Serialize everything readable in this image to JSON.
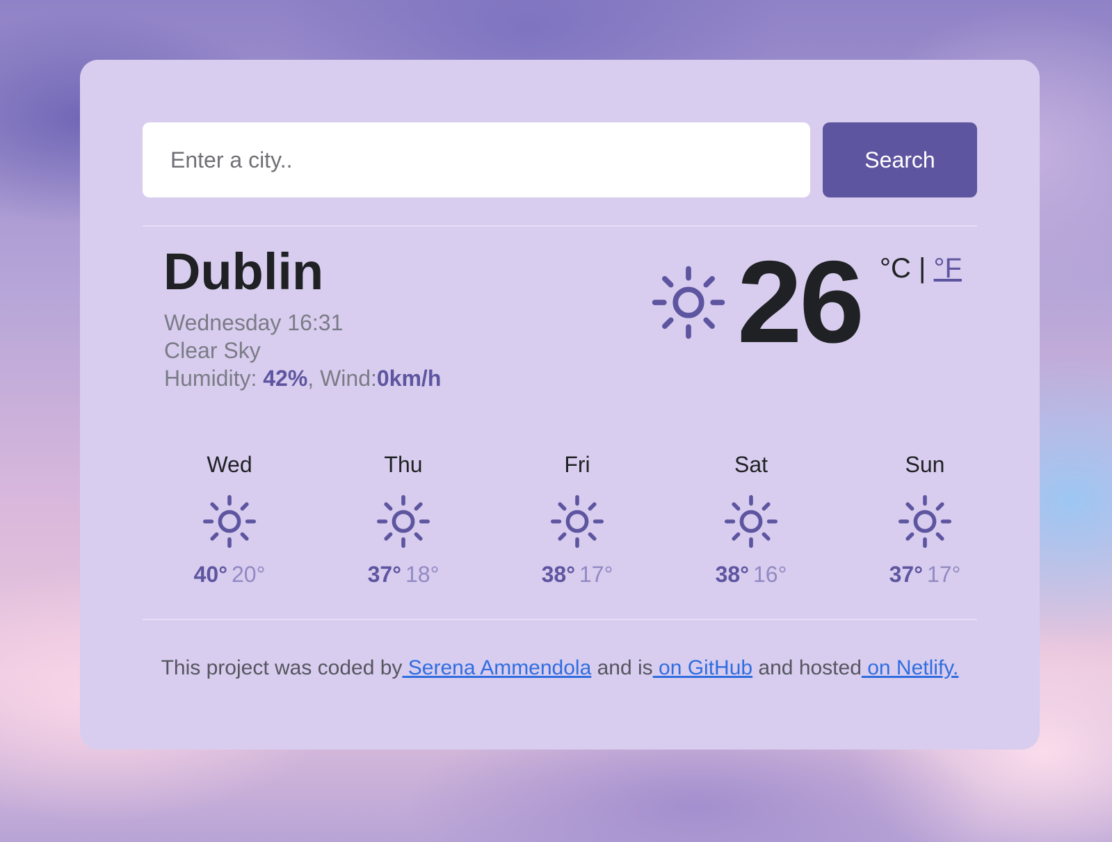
{
  "search": {
    "placeholder": "Enter a city..",
    "value": "",
    "button_label": "Search"
  },
  "current": {
    "city": "Dublin",
    "datetime": "Wednesday 16:31",
    "condition": "Clear Sky",
    "humidity_label": "Humidity: ",
    "humidity_value": "42%",
    "wind_label": ", Wind:",
    "wind_value": "0km/h",
    "temperature": "26",
    "unit_celsius": "°C",
    "unit_separator": "|",
    "unit_fahrenheit": "°F",
    "icon": "sun-icon"
  },
  "forecast": [
    {
      "day": "Wed",
      "max": "40°",
      "min": "20°",
      "icon": "sun-icon"
    },
    {
      "day": "Thu",
      "max": "37°",
      "min": "18°",
      "icon": "sun-icon"
    },
    {
      "day": "Fri",
      "max": "38°",
      "min": "17°",
      "icon": "sun-icon"
    },
    {
      "day": "Sat",
      "max": "38°",
      "min": "16°",
      "icon": "sun-icon"
    },
    {
      "day": "Sun",
      "max": "37°",
      "min": "17°",
      "icon": "sun-icon"
    }
  ],
  "footer": {
    "text_1": "This project was coded by",
    "author_link": " Serena Ammendola",
    "text_2": " and is",
    "github_link": " on GitHub",
    "text_3": " and hosted",
    "netlify_link": " on Netlify."
  },
  "colors": {
    "accent": "#5e55a0",
    "card_bg": "#d8cdee",
    "link": "#2f6de0",
    "text_dark": "#1f2124",
    "text_muted": "#7b7b87"
  }
}
